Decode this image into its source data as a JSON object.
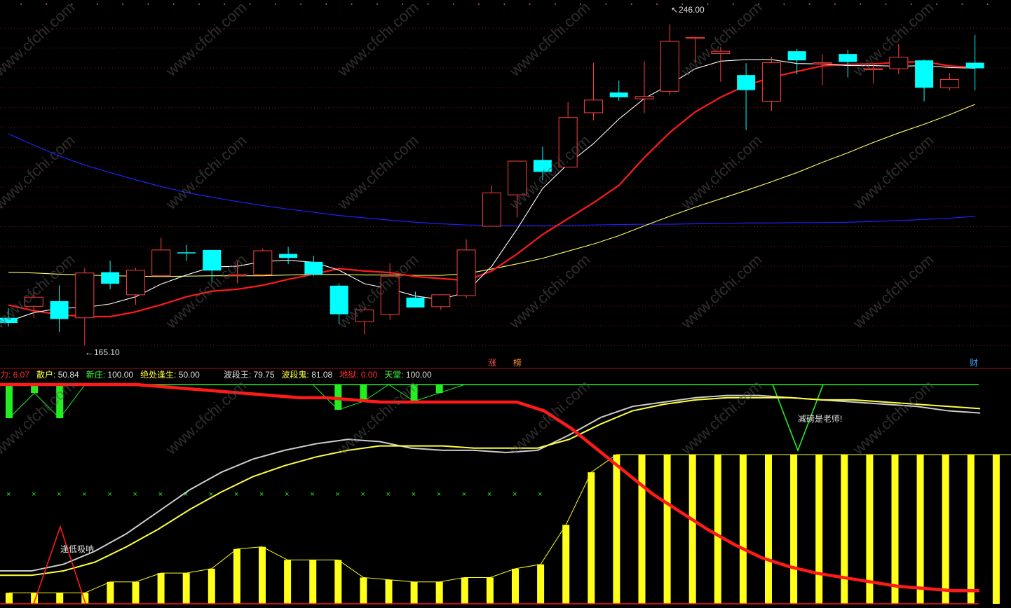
{
  "main_panel": {
    "high_label": "246.00",
    "low_label": "165.10",
    "marker_labels": [
      "涨",
      "榜",
      "财"
    ]
  },
  "indicator_header": [
    {
      "label": "力: ",
      "value": "6.07",
      "color": "#ff3030"
    },
    {
      "label": "散户: ",
      "value": "50.84",
      "color": "#ffff40"
    },
    {
      "label": "新庄: ",
      "value": "100.00",
      "color": "#40ff40"
    },
    {
      "label": "绝处逢生: ",
      "value": "50.00",
      "color": "#ffff40"
    },
    {
      "label": "波段王: ",
      "value": "79.75",
      "color": "#e0e0e0"
    },
    {
      "label": "波段鬼: ",
      "value": "81.08",
      "color": "#ffff40"
    },
    {
      "label": "地狱: ",
      "value": "0.00",
      "color": "#ff3030"
    },
    {
      "label": "天堂: ",
      "value": "100.00",
      "color": "#40ff40"
    }
  ],
  "annotations": {
    "low_buy": "逢低吸呐",
    "reduce": "减磅是老师!"
  },
  "watermark": "www.cfchi.com",
  "chart_data": [
    {
      "type": "candlestick",
      "title": "",
      "ylim": [
        161,
        250
      ],
      "colors": {
        "up": "#ff4040",
        "down": "#00ffff",
        "ma5": "#ffffff",
        "ma10": "#ff1a1a",
        "ma30": "#ffff66",
        "ma120": "#2020ff"
      },
      "candles": [
        {
          "o": 172.0,
          "h": 174.4,
          "l": 169.8,
          "c": 170.7
        },
        {
          "o": 174.9,
          "h": 178.4,
          "l": 172.0,
          "c": 177.2
        },
        {
          "o": 176.2,
          "h": 180.2,
          "l": 168.4,
          "c": 171.7
        },
        {
          "o": 172.0,
          "h": 184.5,
          "l": 165.1,
          "c": 183.3
        },
        {
          "o": 183.5,
          "h": 186.4,
          "l": 179.2,
          "c": 180.6
        },
        {
          "o": 177.8,
          "h": 184.6,
          "l": 175.3,
          "c": 184.0
        },
        {
          "o": 182.6,
          "h": 192.2,
          "l": 182.4,
          "c": 189.1
        },
        {
          "o": 188.5,
          "h": 190.4,
          "l": 186.3,
          "c": 188.4
        },
        {
          "o": 189.1,
          "h": 189.1,
          "l": 181.1,
          "c": 183.9
        },
        {
          "o": 182.9,
          "h": 186.3,
          "l": 180.7,
          "c": 182.9
        },
        {
          "o": 182.9,
          "h": 189.5,
          "l": 182.4,
          "c": 188.9
        },
        {
          "o": 188.1,
          "h": 189.9,
          "l": 185.5,
          "c": 187.1
        },
        {
          "o": 186.1,
          "h": 187.6,
          "l": 182.5,
          "c": 182.9
        },
        {
          "o": 180.1,
          "h": 180.7,
          "l": 170.4,
          "c": 172.9
        },
        {
          "o": 171.0,
          "h": 174.5,
          "l": 167.8,
          "c": 174.0
        },
        {
          "o": 172.9,
          "h": 185.7,
          "l": 171.5,
          "c": 182.5
        },
        {
          "o": 177.1,
          "h": 178.6,
          "l": 174.6,
          "c": 174.6
        },
        {
          "o": 174.8,
          "h": 177.9,
          "l": 174.0,
          "c": 177.8
        },
        {
          "o": 177.6,
          "h": 191.8,
          "l": 177.0,
          "c": 189.1
        },
        {
          "o": 195.1,
          "h": 205.4,
          "l": 195.1,
          "c": 203.5
        },
        {
          "o": 203.0,
          "h": 210.2,
          "l": 197.3,
          "c": 211.5
        },
        {
          "o": 211.8,
          "h": 215.1,
          "l": 206.7,
          "c": 208.8
        },
        {
          "o": 210.0,
          "h": 226.4,
          "l": 210.0,
          "c": 222.5
        },
        {
          "o": 223.7,
          "h": 236.3,
          "l": 221.8,
          "c": 226.9
        },
        {
          "o": 228.8,
          "h": 231.8,
          "l": 226.7,
          "c": 227.6
        },
        {
          "o": 227.2,
          "h": 236.7,
          "l": 223.6,
          "c": 227.8
        },
        {
          "o": 229.1,
          "h": 246.0,
          "l": 228.1,
          "c": 241.7
        },
        {
          "o": 242.6,
          "h": 241.7,
          "l": 236.3,
          "c": 242.7
        },
        {
          "o": 238.6,
          "h": 240.3,
          "l": 231.5,
          "c": 239.2
        },
        {
          "o": 233.2,
          "h": 236.2,
          "l": 219.3,
          "c": 229.4
        },
        {
          "o": 226.6,
          "h": 237.8,
          "l": 224.1,
          "c": 236.3
        },
        {
          "o": 239.2,
          "h": 239.8,
          "l": 233.4,
          "c": 236.9
        },
        {
          "o": 236.3,
          "h": 238.4,
          "l": 230.6,
          "c": 236.3
        },
        {
          "o": 238.5,
          "h": 239.6,
          "l": 232.6,
          "c": 236.5
        },
        {
          "o": 234.8,
          "h": 235.9,
          "l": 231.0,
          "c": 234.8
        },
        {
          "o": 234.8,
          "h": 241.0,
          "l": 233.4,
          "c": 237.7
        },
        {
          "o": 236.9,
          "h": 237.1,
          "l": 226.6,
          "c": 230.0
        },
        {
          "o": 230.0,
          "h": 233.7,
          "l": 229.3,
          "c": 232.1
        },
        {
          "o": 236.3,
          "h": 243.3,
          "l": 229.3,
          "c": 234.9
        }
      ],
      "ma5": [
        171.1,
        173.3,
        174.4,
        174.6,
        175.5,
        177.3,
        180.5,
        182.8,
        184.8,
        185.0,
        186.2,
        186.5,
        186.0,
        184.0,
        180.6,
        179.3,
        177.5,
        176.6,
        178.5,
        185.0,
        194.4,
        204.6,
        210.8,
        215.9,
        222.1,
        227.3,
        230.8,
        234.8,
        236.7,
        237.1,
        237.1,
        236.1,
        236.0,
        235.6,
        235.6,
        235.4,
        235.6,
        235.1,
        234.9
      ],
      "ma10": [
        175.2,
        173.8,
        172.8,
        172.3,
        172.3,
        173.5,
        175.3,
        177.3,
        178.7,
        179.2,
        180.2,
        181.7,
        183.0,
        184.4,
        183.8,
        183.4,
        182.4,
        181.9,
        181.4,
        183.8,
        188.1,
        193.0,
        197.0,
        201.0,
        205.4,
        212.4,
        218.7,
        223.9,
        227.6,
        230.6,
        232.6,
        234.1,
        235.5,
        235.9,
        236.0,
        236.4,
        236.6,
        235.5,
        235.1
      ],
      "ma30": [
        183.5,
        183.3,
        183.0,
        182.8,
        182.6,
        182.5,
        182.4,
        182.5,
        182.6,
        182.6,
        182.6,
        182.8,
        182.9,
        182.9,
        182.8,
        182.8,
        182.7,
        182.7,
        183.1,
        184.3,
        185.6,
        187.0,
        188.8,
        190.6,
        192.7,
        195.2,
        197.6,
        199.9,
        202.0,
        204.1,
        206.3,
        208.6,
        211.2,
        213.6,
        216.2,
        218.6,
        220.8,
        223.2,
        225.8
      ],
      "ma120": [
        218.4,
        215.5,
        212.8,
        210.5,
        208.6,
        206.8,
        205.1,
        203.6,
        202.4,
        201.3,
        200.3,
        199.4,
        198.6,
        197.8,
        197.2,
        196.6,
        196.1,
        195.7,
        195.4,
        195.3,
        195.2,
        195.2,
        195.3,
        195.4,
        195.5,
        195.6,
        195.6,
        195.7,
        195.8,
        195.9,
        195.9,
        196.0,
        196.0,
        196.1,
        196.3,
        196.5,
        196.8,
        197.1,
        197.6
      ]
    },
    {
      "type": "bar",
      "title": "",
      "ylim": [
        0,
        100
      ],
      "series": [
        {
          "name": "散户",
          "type": "bar",
          "color": "#ffff1a",
          "values": [
            5,
            5,
            5,
            5,
            10,
            10,
            14,
            14,
            16,
            25,
            26,
            20,
            20,
            20,
            12,
            11,
            10,
            10,
            12,
            12,
            16,
            18,
            36,
            60,
            76,
            77,
            78,
            80,
            82,
            84,
            96,
            100,
            101,
            98,
            86,
            86,
            87,
            87,
            86,
            84,
            82,
            79,
            77,
            77,
            78
          ]
        },
        {
          "name": "力",
          "type": "line",
          "color": "#ff1a1a",
          "values": [
            100,
            100,
            100,
            100,
            100,
            100,
            99,
            98,
            97,
            96,
            95,
            94,
            94,
            93,
            92,
            92,
            92,
            92,
            92,
            92,
            88,
            80,
            70,
            60,
            50,
            42,
            34,
            27,
            21,
            17,
            14,
            12,
            10,
            8,
            7,
            6,
            6
          ]
        },
        {
          "name": "波段王",
          "type": "line",
          "color": "#cccccc",
          "values": [
            15,
            15,
            18,
            24,
            32,
            42,
            52,
            60,
            66,
            70,
            73,
            75,
            74,
            71,
            70,
            70,
            69,
            70,
            77,
            85,
            90,
            92,
            94,
            95,
            95,
            94,
            93,
            92,
            91,
            90,
            88,
            87
          ]
        },
        {
          "name": "波段鬼",
          "type": "line",
          "color": "#ffff40",
          "values": [
            13,
            13,
            15,
            19,
            26,
            34,
            43,
            51,
            58,
            63,
            67,
            70,
            72,
            72,
            72,
            71,
            71,
            71,
            75,
            82,
            88,
            91,
            93,
            94,
            94,
            94,
            93,
            93,
            92,
            91,
            90,
            89
          ]
        },
        {
          "name": "新庄",
          "type": "bar",
          "color": "#22ee22",
          "values": [
            20,
            5,
            20,
            0,
            0,
            0,
            0,
            0,
            0,
            0,
            0,
            0,
            0,
            15,
            10,
            0,
            10,
            5,
            0
          ]
        }
      ]
    }
  ]
}
